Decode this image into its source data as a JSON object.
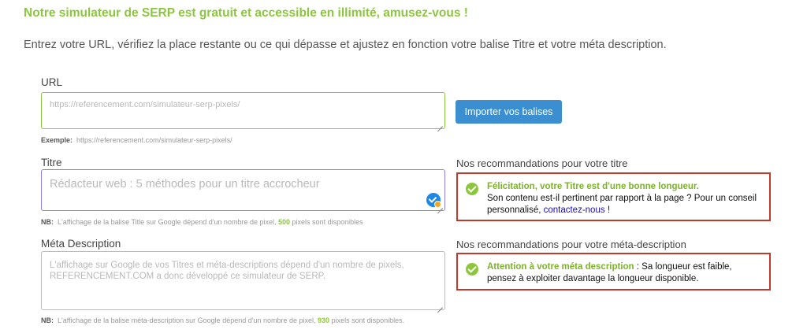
{
  "headline": "Notre simulateur de SERP est gratuit et accessible en illimité, amusez-vous !",
  "intro": "Entrez votre URL, vérifiez la place restante ou ce qui dépasse et ajustez en fonction votre balise Titre et votre méta description.",
  "url": {
    "label": "URL",
    "placeholder": "https://referencement.com/simulateur-serp-pixels/",
    "example_label": "Exemple:",
    "example_value": "https://referencement.com/simulateur-serp-pixels/"
  },
  "import_button": "Importer vos balises",
  "title_field": {
    "label": "Titre",
    "placeholder": "Rédacteur web : 5 méthodes pour un titre accrocheur",
    "nb_label": "NB:",
    "nb_before": "L'affichage de la balise Title sur Google dépend d'un nombre de pixel,",
    "nb_number": "500",
    "nb_after": "pixels sont disponibles"
  },
  "meta_field": {
    "label": "Méta Description",
    "placeholder_line1": "L'affichage sur Google de vos Titres et méta-descriptions dépend d'un nombre de pixels,",
    "placeholder_line2": "REFERENCEMENT.COM a donc développé ce simulateur de SERP.",
    "nb_label": "NB:",
    "nb_before": "L'affichage de la balise méta-description sur Google dépend d'un nombre de pixel,",
    "nb_number": "930",
    "nb_after": "pixels sont disponibles."
  },
  "title_reco": {
    "heading": "Nos recommandations pour votre titre",
    "highlight": "Félicitation, votre Titre est d'une bonne longueur.",
    "line2": "Son contenu est-il pertinent par rapport à la page ? Pour un conseil",
    "line3_before": "personnalisé,",
    "link": "contactez-nous",
    "line3_after": "!"
  },
  "meta_reco": {
    "heading": "Nos recommandations pour votre méta-description",
    "highlight": "Attention à votre méta description",
    "line1_rest": ": Sa longueur est faible,",
    "line2": "pensez à exploiter davantage la longueur disponible."
  },
  "colors": {
    "accent_green": "#8cc63f",
    "button_blue": "#3b8ed0",
    "alert_red": "#c0392b",
    "title_border": "#8b7fe0",
    "url_border": "#8cc63f"
  },
  "icons": [
    "check-circle-icon",
    "grammarly-badge-icon",
    "resize-grip-icon"
  ]
}
